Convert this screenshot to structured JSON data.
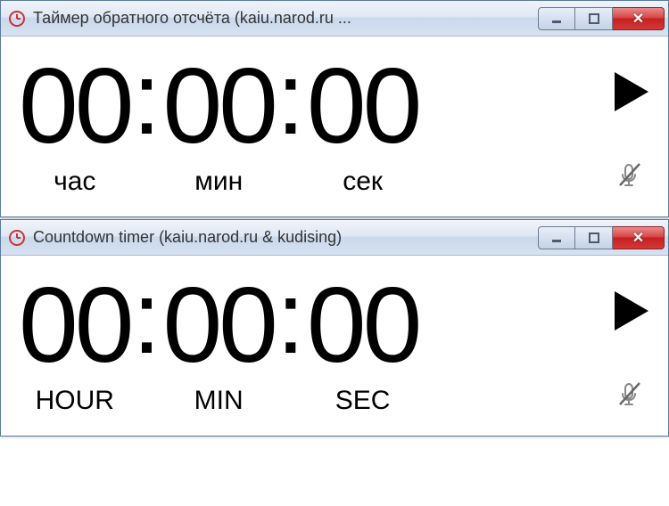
{
  "windows": [
    {
      "title": "Таймер обратного отсчёта (kaiu.narod.ru ...",
      "hours": "00",
      "minutes": "00",
      "seconds": "00",
      "hour_label": "час",
      "min_label": "мин",
      "sec_label": "сек",
      "labels_class": "unit-label-lower"
    },
    {
      "title": "Countdown timer (kaiu.narod.ru & kudising)",
      "hours": "00",
      "minutes": "00",
      "seconds": "00",
      "hour_label": "HOUR",
      "min_label": "MIN",
      "sec_label": "SEC",
      "labels_class": ""
    }
  ],
  "separator": ":",
  "controls": {
    "minimize_glyph": "—",
    "close_glyph": "✕"
  }
}
